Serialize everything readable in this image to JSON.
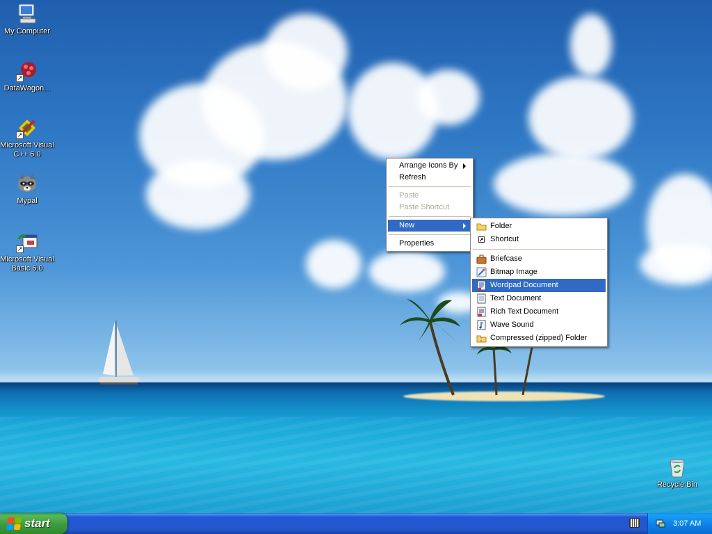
{
  "desktop": {
    "icons": [
      {
        "label": "My Computer",
        "icon": "my-computer-icon"
      },
      {
        "label": "DataWagon...",
        "icon": "datawagon-icon"
      },
      {
        "label": "Microsoft Visual C++ 6.0",
        "icon": "visual-cpp-icon"
      },
      {
        "label": "Mypal",
        "icon": "mypal-raccoon-icon"
      },
      {
        "label": "Microsoft Visual Basic 6.0",
        "icon": "visual-basic-icon"
      },
      {
        "label": "Recycle Bin",
        "icon": "recycle-bin-icon"
      }
    ]
  },
  "context_menu": {
    "items": [
      {
        "label": "Arrange Icons By",
        "submenu": true,
        "enabled": true
      },
      {
        "label": "Refresh",
        "enabled": true
      },
      {
        "label": "Paste",
        "enabled": false
      },
      {
        "label": "Paste Shortcut",
        "enabled": false
      },
      {
        "label": "New",
        "submenu": true,
        "enabled": true,
        "highlighted": true
      },
      {
        "label": "Properties",
        "enabled": true
      }
    ]
  },
  "new_submenu": {
    "items": [
      {
        "label": "Folder",
        "icon": "folder-icon"
      },
      {
        "label": "Shortcut",
        "icon": "shortcut-icon"
      },
      {
        "label": "Briefcase",
        "icon": "briefcase-icon"
      },
      {
        "label": "Bitmap Image",
        "icon": "bitmap-image-icon"
      },
      {
        "label": "Wordpad Document",
        "icon": "wordpad-document-icon",
        "highlighted": true
      },
      {
        "label": "Text Document",
        "icon": "text-document-icon"
      },
      {
        "label": "Rich Text Document",
        "icon": "rich-text-document-icon"
      },
      {
        "label": "Wave Sound",
        "icon": "wave-sound-icon"
      },
      {
        "label": "Compressed (zipped) Folder",
        "icon": "zipped-folder-icon"
      }
    ]
  },
  "taskbar": {
    "start_label": "start",
    "clock": "3:07 AM"
  },
  "colors": {
    "menu_highlight": "#316ac5",
    "taskbar_blue": "#2457cc",
    "start_green": "#3d9b3d"
  }
}
